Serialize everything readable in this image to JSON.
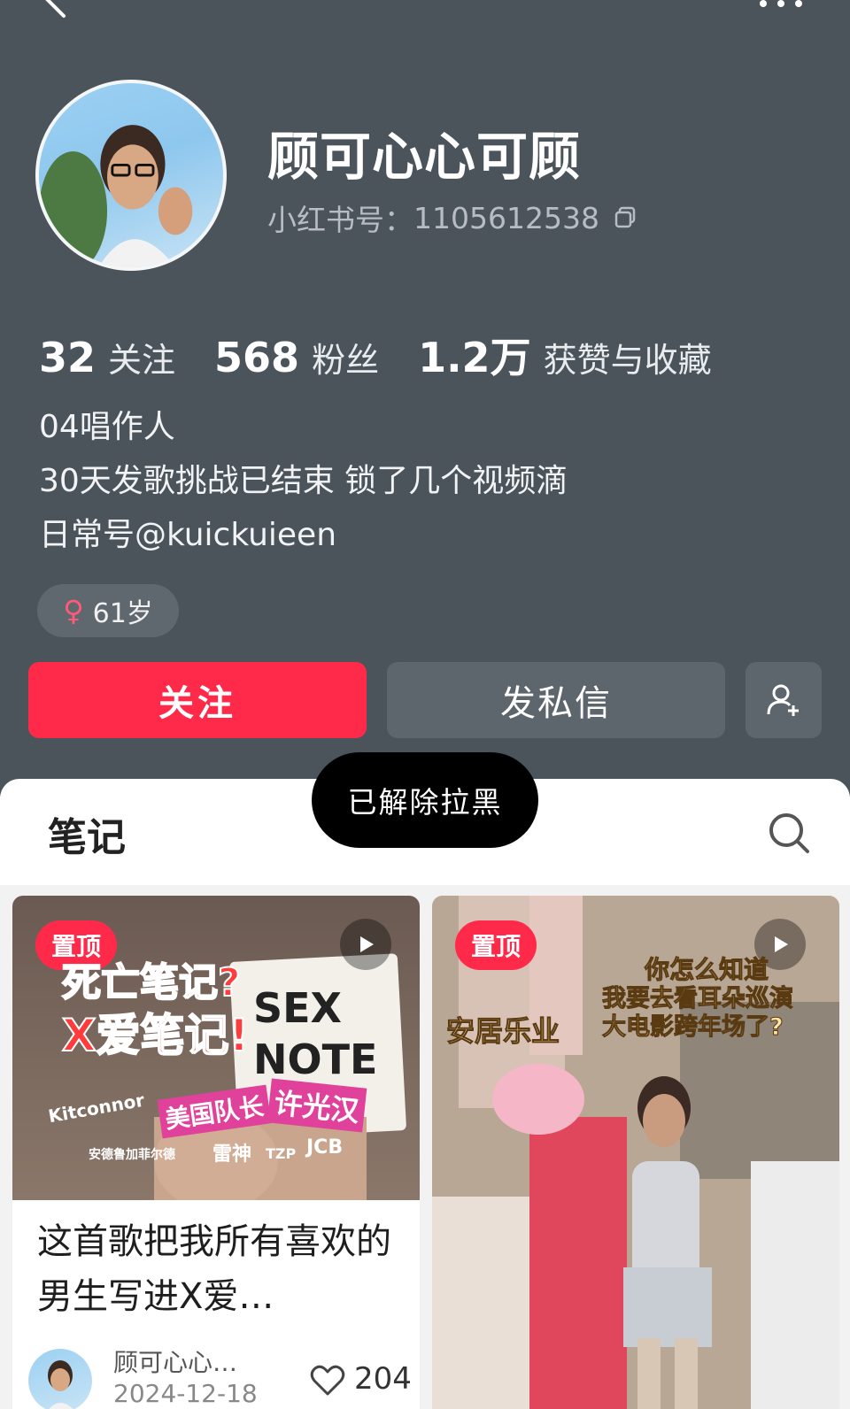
{
  "profile": {
    "name": "顾可心心可顾",
    "id_label": "小红书号：",
    "id_value": "1105612538"
  },
  "stats": [
    {
      "num": "32",
      "label": "关注"
    },
    {
      "num": "568",
      "label": "粉丝"
    },
    {
      "num": "1.2万",
      "label": "获赞与收藏"
    }
  ],
  "bio": {
    "line1": "04唱作人",
    "line2": "30天发歌挑战已结束 锁了几个视频滴",
    "line3": "日常号@kuickuieen"
  },
  "tag": {
    "gender_symbol": "♀",
    "age": "61岁"
  },
  "actions": {
    "follow": "关注",
    "message": "发私信"
  },
  "toast": "已解除拉黑",
  "tabs": {
    "notes": "笔记"
  },
  "cards": [
    {
      "pin": "置顶",
      "cover_text": {
        "a": "死亡笔记?",
        "b": "X爱笔记!",
        "c": "SEX NOTE",
        "d": "美国队长",
        "e": "许光汉",
        "f": "Kitconnor",
        "g": "雷神",
        "h": "JCB",
        "i": "安德鲁加菲尔德",
        "j": "TZP"
      },
      "title": "这首歌把我所有喜欢的男生写进X爱…",
      "author": "顾可心心…",
      "date": "2024-12-18",
      "likes": "204"
    },
    {
      "pin": "置顶",
      "cover_text": {
        "a": "你怎么知道",
        "b": "我要去看耳朵巡演",
        "c": "大电影跨年场了?",
        "d": "安居乐业"
      }
    }
  ],
  "colors": {
    "header_bg": "#4b535b",
    "accent": "#ff2a4a",
    "button_dark": "#5d656d"
  }
}
